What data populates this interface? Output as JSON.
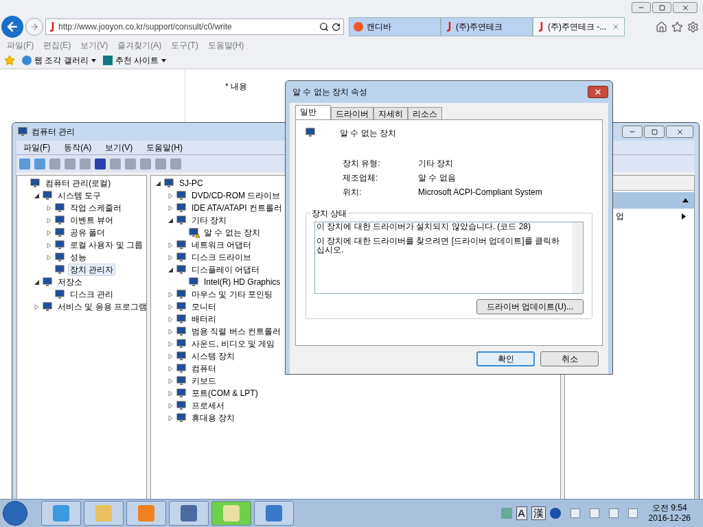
{
  "browser": {
    "address": "http://www.jooyon.co.kr/support/consult/c0/write",
    "tabs": [
      {
        "label": "캔디바",
        "selected": false
      },
      {
        "label": "(주)주연테크",
        "selected": false
      },
      {
        "label": "(주)주연테크 -...",
        "selected": true
      }
    ],
    "menu": [
      "파일(F)",
      "편집(E)",
      "보기(V)",
      "즐겨찾기(A)",
      "도구(T)",
      "도움말(H)"
    ],
    "favorites": [
      "웹 조각 갤러리",
      "추천 사이트"
    ],
    "page": {
      "field_label": "* 내용"
    }
  },
  "computer_management": {
    "title": "컴퓨터 관리",
    "menu": [
      "파일(F)",
      "동작(A)",
      "보기(V)",
      "도움말(H)"
    ],
    "tree": [
      {
        "label": "컴퓨터 관리(로컬)",
        "selected": false,
        "children": [
          {
            "label": "시스템 도구",
            "expanded": true,
            "selected": false,
            "children": [
              {
                "label": "작업 스케줄러",
                "expanded": false,
                "selected": false
              },
              {
                "label": "이벤트 뷰어",
                "expanded": false,
                "selected": false
              },
              {
                "label": "공유 폴더",
                "expanded": false,
                "selected": false
              },
              {
                "label": "로컬 사용자 및 그룹",
                "expanded": false,
                "selected": false
              },
              {
                "label": "성능",
                "expanded": false,
                "selected": false
              },
              {
                "label": "장치 관리자",
                "selected": true
              }
            ]
          },
          {
            "label": "저장소",
            "expanded": true,
            "selected": false,
            "children": [
              {
                "label": "디스크 관리",
                "selected": false
              }
            ]
          },
          {
            "label": "서비스 및 응용 프로그램",
            "expanded": false,
            "selected": false
          }
        ]
      }
    ],
    "devices": [
      {
        "label": "SJ-PC",
        "expanded": true,
        "children": [
          {
            "label": "DVD/CD-ROM 드라이브",
            "expanded": false
          },
          {
            "label": "IDE ATA/ATAPI 컨트롤러",
            "expanded": false
          },
          {
            "label": "기타 장치",
            "expanded": true,
            "children": [
              {
                "label": "알 수 없는 장치",
                "kind": "warning"
              }
            ]
          },
          {
            "label": "네트워크 어댑터",
            "expanded": false
          },
          {
            "label": "디스크 드라이브",
            "expanded": false
          },
          {
            "label": "디스플레이 어댑터",
            "expanded": true,
            "children": [
              {
                "label": "Intel(R) HD Graphics",
                "kind": "device"
              }
            ]
          },
          {
            "label": "마우스 및 기타 포인팅",
            "expanded": false
          },
          {
            "label": "모니터",
            "expanded": false
          },
          {
            "label": "배터리",
            "expanded": false
          },
          {
            "label": "범용 직렬 버스 컨트롤러",
            "expanded": false
          },
          {
            "label": "사운드, 비디오 및 게임",
            "expanded": false
          },
          {
            "label": "시스템 장치",
            "expanded": false
          },
          {
            "label": "컴퓨터",
            "expanded": false
          },
          {
            "label": "키보드",
            "expanded": false
          },
          {
            "label": "포트(COM & LPT)",
            "expanded": false
          },
          {
            "label": "프로세서",
            "expanded": false
          },
          {
            "label": "휴대용 장치",
            "expanded": false
          }
        ]
      }
    ],
    "actions": {
      "item": "업"
    }
  },
  "dialog": {
    "title": "알 수 없는 장치 속성",
    "tabs": [
      {
        "label": "일반",
        "selected": true
      },
      {
        "label": "드라이버",
        "selected": false
      },
      {
        "label": "자세히",
        "selected": false
      },
      {
        "label": "리소스",
        "selected": false
      }
    ],
    "device_name": "알 수 없는 장치",
    "properties": [
      {
        "label": "장치 유형:",
        "value": "기타 장치"
      },
      {
        "label": "제조업체:",
        "value": "알 수 없음"
      },
      {
        "label": "위치:",
        "value": "Microsoft ACPI-Compliant System"
      }
    ],
    "status_title": "장치 상태",
    "status_lines": [
      "이 장치에 대한 드라이버가 설치되지 않았습니다. (코드 28)",
      "이 장치에 대한 드라이버를 찾으려면 [드라이버 업데이트]를 클릭하십시오."
    ],
    "update_button": "드라이버 업데이트(U)...",
    "buttons": [
      {
        "label": "확인",
        "default": true
      },
      {
        "label": "취소",
        "default": false
      }
    ]
  },
  "taskbar": {
    "ime": [
      "A",
      "漢"
    ],
    "time": "오전 9:54",
    "date": "2016-12-26"
  }
}
